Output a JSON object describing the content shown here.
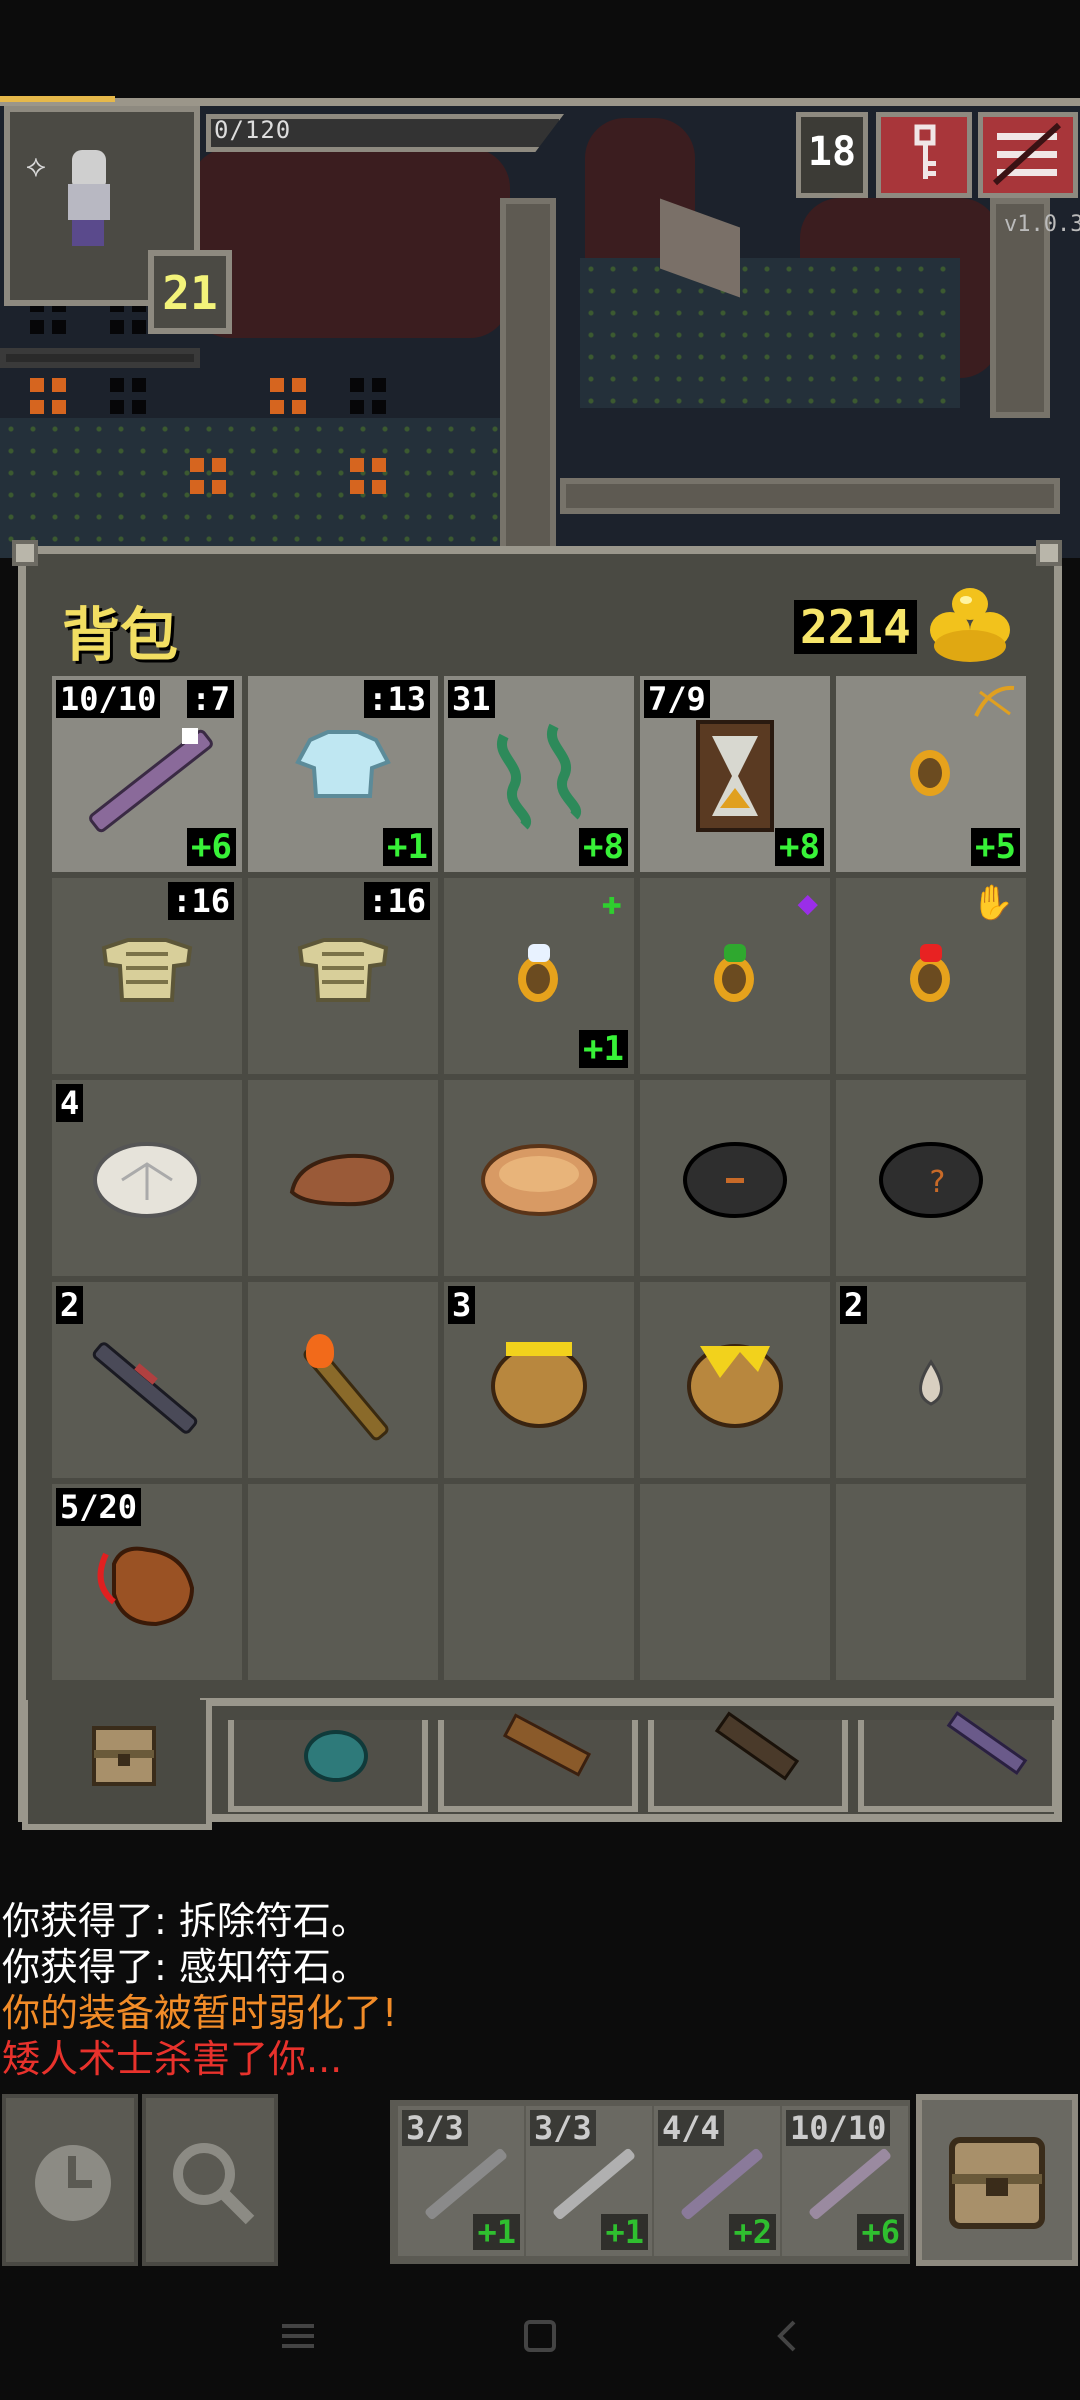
{
  "status": {
    "exp_text": "0/120",
    "hero_level": "21",
    "depth": "18",
    "version": "v1.0.3"
  },
  "inventory": {
    "title": "背包",
    "gold": "2214",
    "rows": [
      [
        {
          "item": "wand",
          "qty": "10/10",
          "lvl": ":7",
          "plus": "+6",
          "equipped": true
        },
        {
          "item": "armor-cloth",
          "lvl": ":13",
          "plus": "+1",
          "equipped": true
        },
        {
          "item": "artifact-chains",
          "qty": "31",
          "plus": "+8",
          "equipped": true
        },
        {
          "item": "artifact-hourglass",
          "qty": "7/9",
          "plus": "+8",
          "equipped": true
        },
        {
          "item": "ring",
          "plus": "+5",
          "mark": "bow",
          "equipped": true
        }
      ],
      [
        {
          "item": "armor-scale",
          "lvl": ":16"
        },
        {
          "item": "armor-scale",
          "lvl": ":16"
        },
        {
          "item": "ring",
          "plus": "+1",
          "mark": "green-cross"
        },
        {
          "item": "ring",
          "mark": "purple-gem"
        },
        {
          "item": "ring",
          "mark": "red-hand"
        }
      ],
      [
        {
          "item": "stone-white",
          "qty": "4"
        },
        {
          "item": "meat-brown"
        },
        {
          "item": "pasty"
        },
        {
          "item": "stone-dark"
        },
        {
          "item": "stone-dark-unknown"
        }
      ],
      [
        {
          "item": "dart",
          "qty": "2"
        },
        {
          "item": "torch"
        },
        {
          "item": "honey-pot",
          "qty": "3"
        },
        {
          "item": "honey-pot-shattered"
        },
        {
          "item": "seed",
          "qty": "2"
        }
      ],
      [
        {
          "item": "waterskin",
          "qty": "5/20"
        },
        {
          "item": "empty"
        },
        {
          "item": "empty"
        },
        {
          "item": "empty"
        },
        {
          "item": "empty"
        }
      ]
    ]
  },
  "log": [
    {
      "text": "你获得了: 拆除符石。",
      "color": "#ffffff"
    },
    {
      "text": "你获得了: 感知符石。",
      "color": "#ffffff"
    },
    {
      "text": "你的装备被暂时弱化了!",
      "color": "#f28c28"
    },
    {
      "text": "矮人术士杀害了你...",
      "color": "#e8322c"
    }
  ],
  "quickslots": [
    {
      "qty": "3/3",
      "plus": "+1"
    },
    {
      "qty": "3/3",
      "plus": "+1"
    },
    {
      "qty": "4/4",
      "plus": "+2"
    },
    {
      "qty": "10/10",
      "plus": "+6"
    }
  ]
}
